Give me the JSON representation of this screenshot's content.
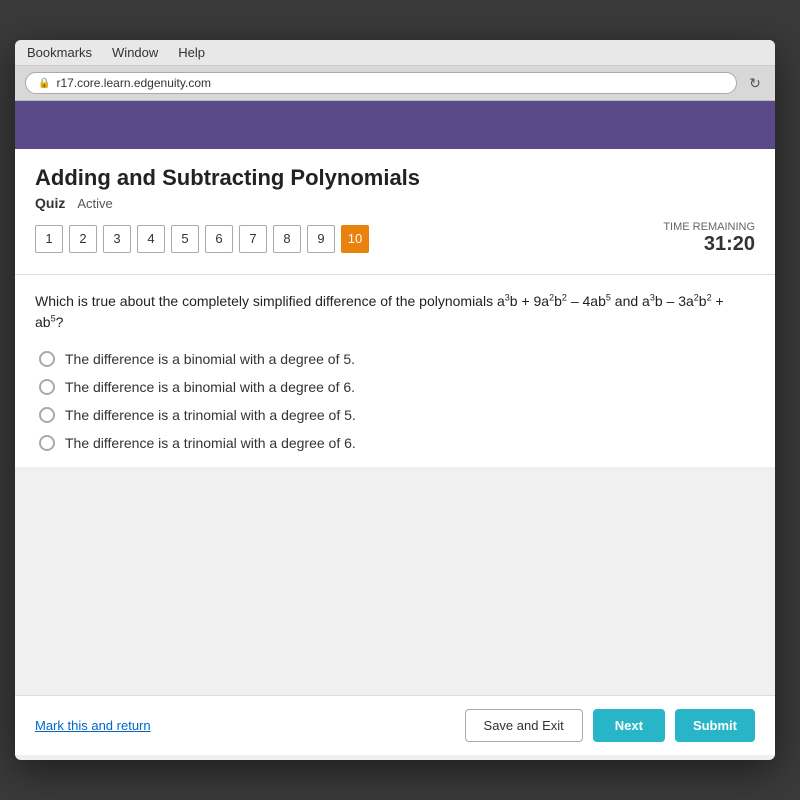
{
  "desktop": {
    "background_color": "#3a3a3a"
  },
  "browser": {
    "menu_bar": {
      "items": [
        "Bookmarks",
        "Window",
        "Help"
      ]
    },
    "url_bar": {
      "url": "r17.core.learn.edgenuity.com",
      "lock_icon": "🔒"
    },
    "refresh_icon": "↻"
  },
  "page": {
    "title": "Adding and Subtracting Polynomials",
    "quiz_label": "Quiz",
    "status_label": "Active",
    "question_numbers": [
      {
        "num": "1",
        "current": false
      },
      {
        "num": "2",
        "current": false
      },
      {
        "num": "3",
        "current": false
      },
      {
        "num": "4",
        "current": false
      },
      {
        "num": "5",
        "current": false
      },
      {
        "num": "6",
        "current": false
      },
      {
        "num": "7",
        "current": false
      },
      {
        "num": "8",
        "current": false
      },
      {
        "num": "9",
        "current": false
      },
      {
        "num": "10",
        "current": true
      }
    ],
    "time_remaining_label": "TIME REMAINING",
    "time_remaining_value": "31:20",
    "question": {
      "text_prefix": "Which is true about the completely simplified difference of the polynomials a",
      "text_suffix": "b + 9a²b² – 4ab⁵ and a³b – 3a²b² + ab⁵?",
      "exp_a3": "3",
      "options": [
        {
          "id": "opt1",
          "text": "The difference is a binomial with a degree of 5."
        },
        {
          "id": "opt2",
          "text": "The difference is a binomial with a degree of 6."
        },
        {
          "id": "opt3",
          "text": "The difference is a trinomial with a degree of 5."
        },
        {
          "id": "opt4",
          "text": "The difference is a trinomial with a degree of 6."
        }
      ]
    },
    "bottom": {
      "mark_return_label": "Mark this and return",
      "save_exit_label": "Save and Exit",
      "next_label": "Next",
      "submit_label": "Submit"
    }
  }
}
